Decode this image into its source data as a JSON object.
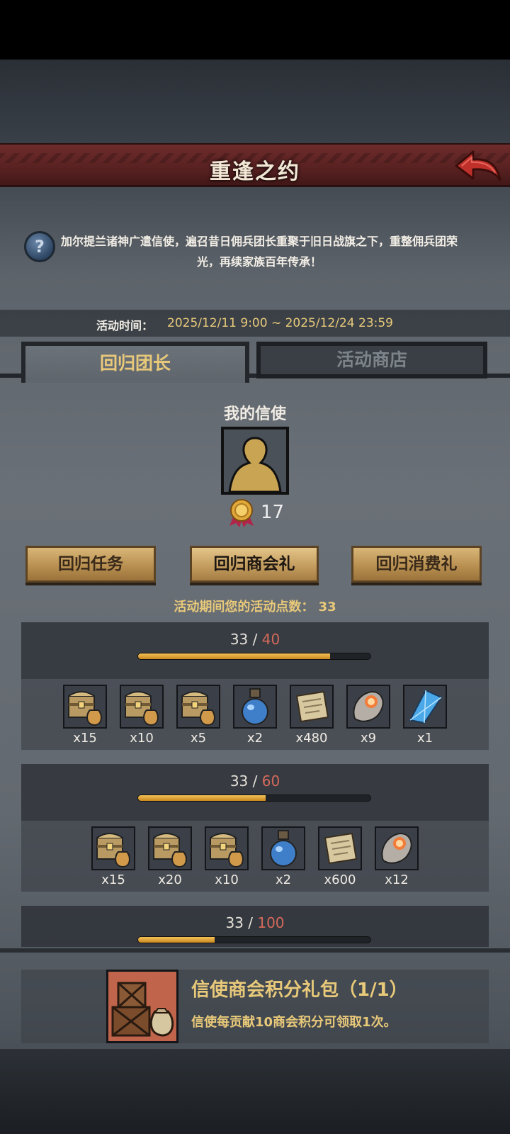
{
  "header": {
    "title": "重逢之约"
  },
  "description": "加尔提兰诸神广遣信使，遍召昔日佣兵团长重聚于旧日战旗之下，重整佣兵团荣光，再续家族百年传承！",
  "activity_time": {
    "label": "活动时间：",
    "value": "2025/12/11 9:00 ~ 2025/12/24 23:59"
  },
  "tabs": [
    {
      "label": "回归团长",
      "active": true
    },
    {
      "label": "活动商店",
      "active": false
    }
  ],
  "messenger": {
    "label": "我的信使",
    "medal_count": "17"
  },
  "mode_buttons": [
    {
      "label": "回归任务"
    },
    {
      "label": "回归商会礼"
    },
    {
      "label": "回归消费礼"
    }
  ],
  "points": {
    "text": "活动期间您的活动点数： 33"
  },
  "tiers": [
    {
      "current": "33",
      "goal": "40",
      "progress": 0.825,
      "items": [
        {
          "icon": "treasure-chest-icon",
          "qty": "x15"
        },
        {
          "icon": "treasure-chest-icon",
          "qty": "x10"
        },
        {
          "icon": "treasure-chest-icon",
          "qty": "x5"
        },
        {
          "icon": "potion-icon",
          "qty": "x2"
        },
        {
          "icon": "scroll-icon",
          "qty": "x480"
        },
        {
          "icon": "ore-stone-icon",
          "qty": "x9"
        },
        {
          "icon": "blue-crystal-icon",
          "qty": "x1"
        }
      ]
    },
    {
      "current": "33",
      "goal": "60",
      "progress": 0.55,
      "items": [
        {
          "icon": "treasure-chest-icon",
          "qty": "x15"
        },
        {
          "icon": "treasure-chest-icon",
          "qty": "x20"
        },
        {
          "icon": "treasure-chest-icon",
          "qty": "x10"
        },
        {
          "icon": "potion-icon",
          "qty": "x2"
        },
        {
          "icon": "scroll-icon",
          "qty": "x600"
        },
        {
          "icon": "ore-stone-icon",
          "qty": "x12"
        }
      ]
    },
    {
      "current": "33",
      "goal": "100",
      "progress": 0.33,
      "items": []
    }
  ],
  "pack": {
    "title": "信使商会积分礼包（1/1）",
    "desc": "信使每贡献10商会积分可领取1次。"
  },
  "colors": {
    "gold": "#e8c97a",
    "title_bar": "#5a2222",
    "goal_red": "#d46a5a"
  }
}
